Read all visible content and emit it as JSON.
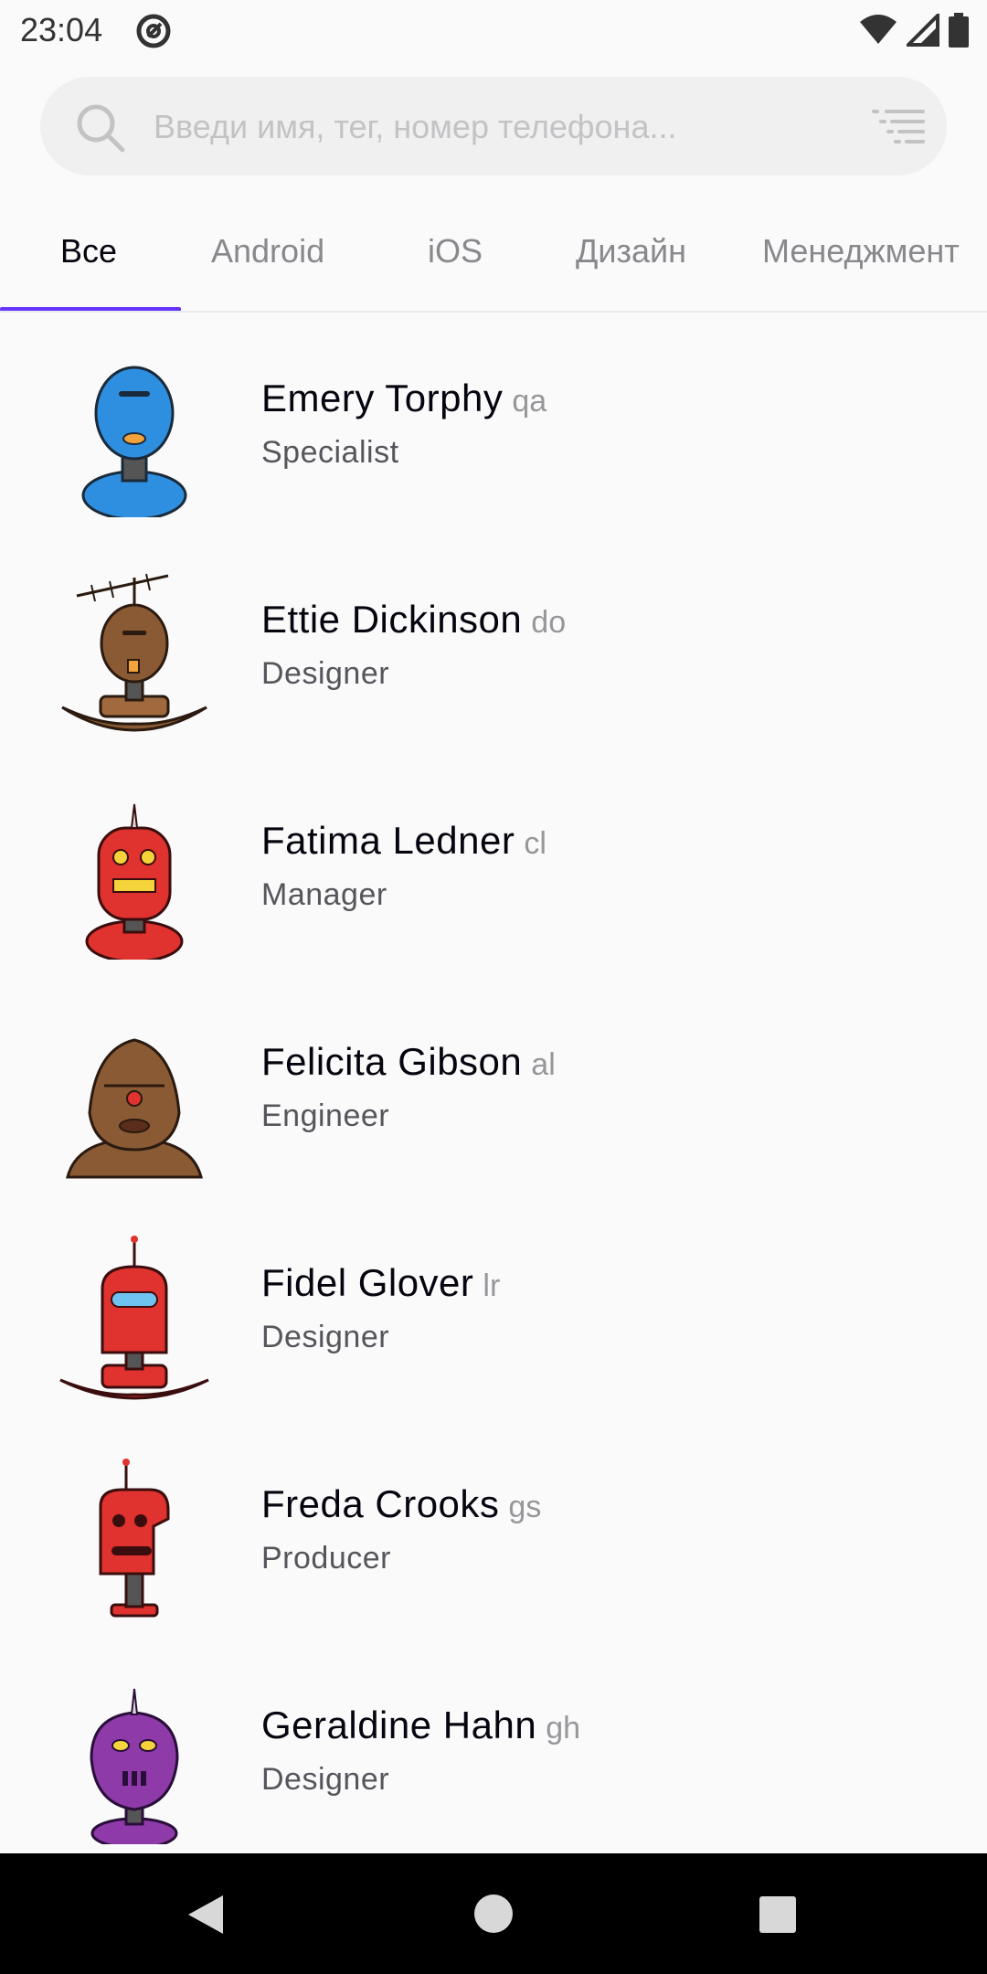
{
  "status_bar": {
    "time": "23:04"
  },
  "search": {
    "placeholder": "Введи имя, тег, номер телефона..."
  },
  "tabs": [
    {
      "label": "Все",
      "active": true
    },
    {
      "label": "Android",
      "active": false
    },
    {
      "label": "iOS",
      "active": false
    },
    {
      "label": "Дизайн",
      "active": false
    },
    {
      "label": "Менеджмент",
      "active": false
    }
  ],
  "people": [
    {
      "name": "Emery Torphy",
      "tag": "qa",
      "position": "Specialist",
      "avatar_color": "#2e8fe0"
    },
    {
      "name": "Ettie Dickinson",
      "tag": "do",
      "position": "Designer",
      "avatar_color": "#8a5a34"
    },
    {
      "name": "Fatima Ledner",
      "tag": "cl",
      "position": "Manager",
      "avatar_color": "#e0322e"
    },
    {
      "name": "Felicita Gibson",
      "tag": "al",
      "position": "Engineer",
      "avatar_color": "#8a5a34"
    },
    {
      "name": "Fidel Glover",
      "tag": "lr",
      "position": "Designer",
      "avatar_color": "#e0322e"
    },
    {
      "name": "Freda Crooks",
      "tag": "gs",
      "position": "Producer",
      "avatar_color": "#e0322e"
    },
    {
      "name": "Geraldine Hahn",
      "tag": "gh",
      "position": "Designer",
      "avatar_color": "#8e3aa8"
    }
  ],
  "colors": {
    "accent": "#6534ff",
    "background": "#fafafa",
    "search_bg": "#f0f0f0"
  },
  "icons": {
    "search": "search-icon",
    "filter": "filter-icon",
    "wifi": "wifi-icon",
    "signal": "signal-icon",
    "battery": "battery-icon",
    "back": "nav-back-icon",
    "home": "nav-home-icon",
    "recents": "nav-recents-icon"
  }
}
